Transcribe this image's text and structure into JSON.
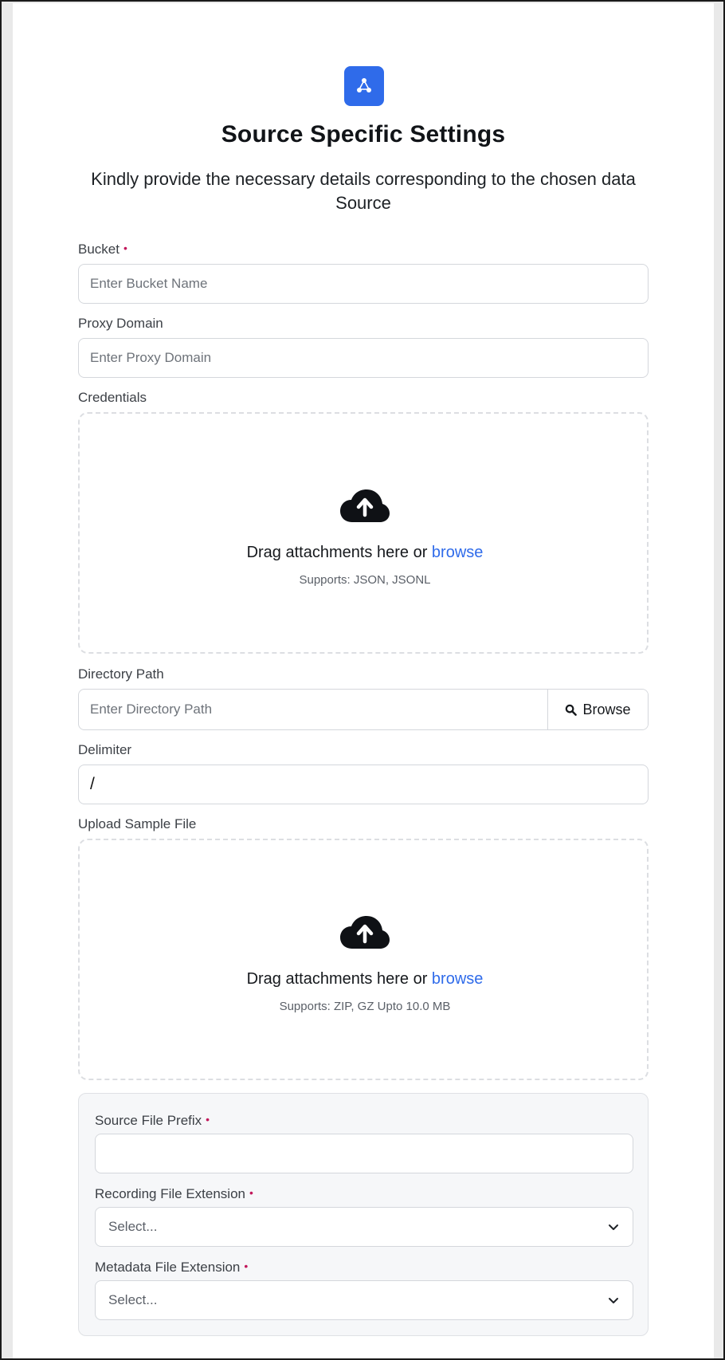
{
  "header": {
    "icon": "share-nodes-icon",
    "brand_color": "#2f6bea",
    "title": "Source Specific Settings",
    "subtitle": "Kindly provide the necessary details corresponding to the chosen data Source"
  },
  "form": {
    "bucket": {
      "label": "Bucket",
      "required_mark": "•",
      "placeholder": "Enter Bucket Name",
      "value": ""
    },
    "proxy_domain": {
      "label": "Proxy Domain",
      "placeholder": "Enter Proxy Domain",
      "value": ""
    },
    "credentials": {
      "label": "Credentials",
      "icon": "cloud-upload-icon",
      "drag_text": "Drag attachments here or",
      "browse_link": "browse",
      "supports": "Supports: JSON, JSONL"
    },
    "directory_path": {
      "label": "Directory Path",
      "placeholder": "Enter Directory Path",
      "value": "",
      "browse_button": "Browse",
      "browse_icon": "search-icon"
    },
    "delimiter": {
      "label": "Delimiter",
      "value": "/"
    },
    "upload_sample_file": {
      "label": "Upload Sample File",
      "icon": "cloud-upload-icon",
      "drag_text": "Drag attachments here or",
      "browse_link": "browse",
      "supports": "Supports: ZIP, GZ Upto 10.0 MB"
    },
    "source_file_prefix": {
      "label": "Source File Prefix",
      "required_mark": "•",
      "value": ""
    },
    "recording_file_extension": {
      "label": "Recording File Extension",
      "required_mark": "•",
      "selected": "Select..."
    },
    "metadata_file_extension": {
      "label": "Metadata File Extension",
      "required_mark": "•",
      "selected": "Select..."
    }
  }
}
